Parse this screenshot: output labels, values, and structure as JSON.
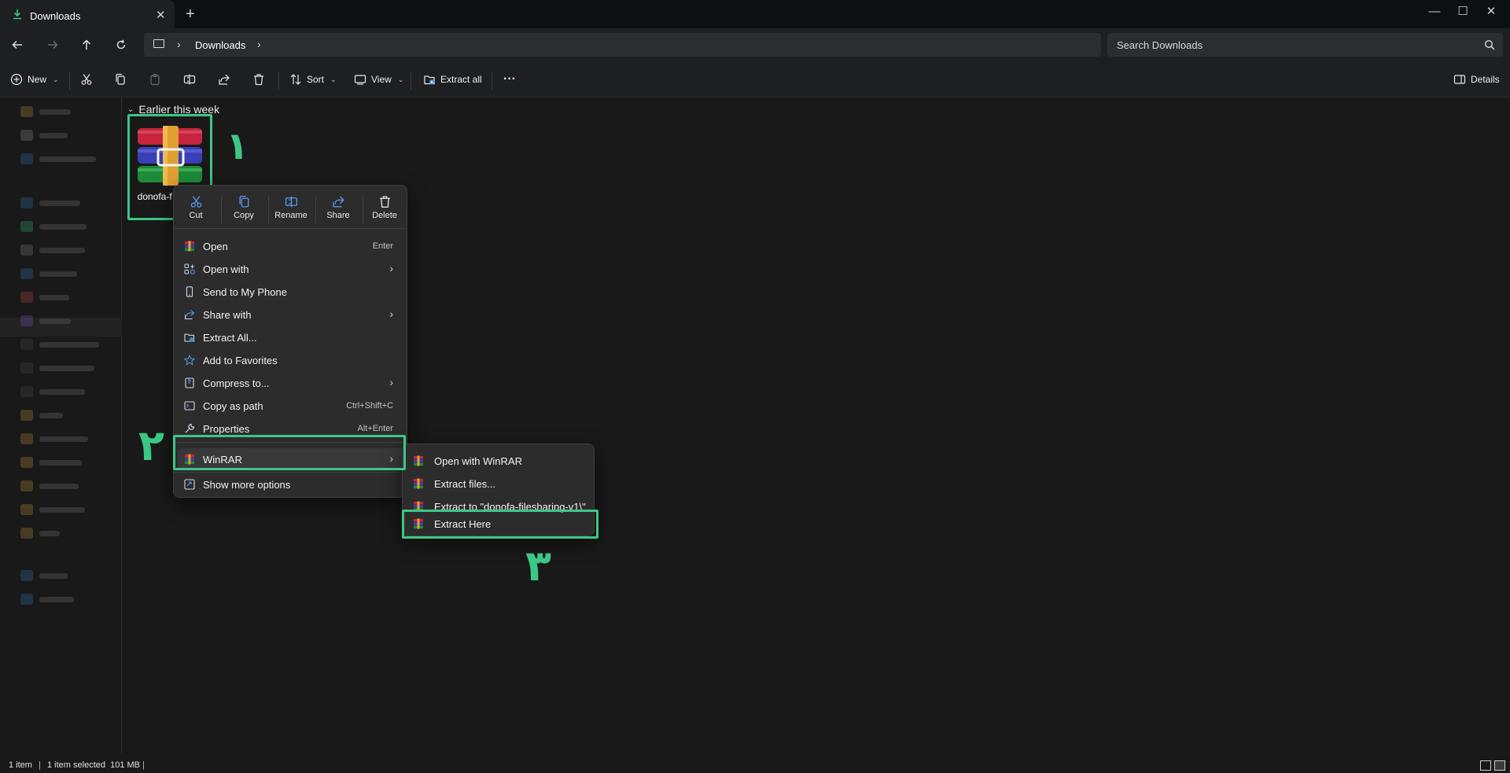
{
  "window": {
    "tab_title": "Downloads",
    "new_tab": "+",
    "controls": {
      "minimize": "—",
      "maximize": "☐",
      "close": "✕"
    }
  },
  "nav": {
    "breadcrumb": [
      "Downloads"
    ],
    "search_placeholder": "Search Downloads"
  },
  "toolbar": {
    "new_label": "New",
    "sort_label": "Sort",
    "view_label": "View",
    "extract_all_label": "Extract all",
    "more_label": "···",
    "details_label": "Details"
  },
  "content": {
    "group_label": "Earlier this week",
    "file": {
      "name": "donofa-f g-v1",
      "icon": "winrar-archive-icon"
    }
  },
  "context_menu": {
    "quick_actions": [
      {
        "label": "Cut",
        "icon": "scissors-icon"
      },
      {
        "label": "Copy",
        "icon": "copy-icon"
      },
      {
        "label": "Rename",
        "icon": "rename-icon"
      },
      {
        "label": "Share",
        "icon": "share-icon"
      },
      {
        "label": "Delete",
        "icon": "trash-icon"
      }
    ],
    "items": [
      {
        "label": "Open",
        "shortcut": "Enter",
        "icon": "winrar-icon"
      },
      {
        "label": "Open with",
        "submenu": true,
        "icon": "open-with-icon"
      },
      {
        "label": "Send to My Phone",
        "icon": "phone-icon"
      },
      {
        "label": "Share with",
        "submenu": true,
        "icon": "share-icon"
      },
      {
        "label": "Extract All...",
        "icon": "extract-icon"
      },
      {
        "label": "Add to Favorites",
        "icon": "star-icon"
      },
      {
        "label": "Compress to...",
        "submenu": true,
        "icon": "compress-icon"
      },
      {
        "label": "Copy as path",
        "shortcut": "Ctrl+Shift+C",
        "icon": "path-icon"
      },
      {
        "label": "Properties",
        "shortcut": "Alt+Enter",
        "icon": "wrench-icon"
      },
      {
        "label": "WinRAR",
        "submenu": true,
        "icon": "winrar-icon"
      },
      {
        "label": "Show more options",
        "icon": "more-options-icon"
      }
    ],
    "winrar_submenu": [
      {
        "label": "Open with WinRAR"
      },
      {
        "label": "Extract files..."
      },
      {
        "label": "Extract to \"donofa-filesharing-v1\\\""
      },
      {
        "label": "Extract Here"
      }
    ]
  },
  "annotations": [
    "۱",
    "۲",
    "۳"
  ],
  "status": {
    "items": "1 item",
    "selected": "1 item selected  101 MB",
    "separator": "|"
  },
  "colors": {
    "highlight": "#3cc785",
    "background": "#191919",
    "menu": "#2c2c2c"
  }
}
